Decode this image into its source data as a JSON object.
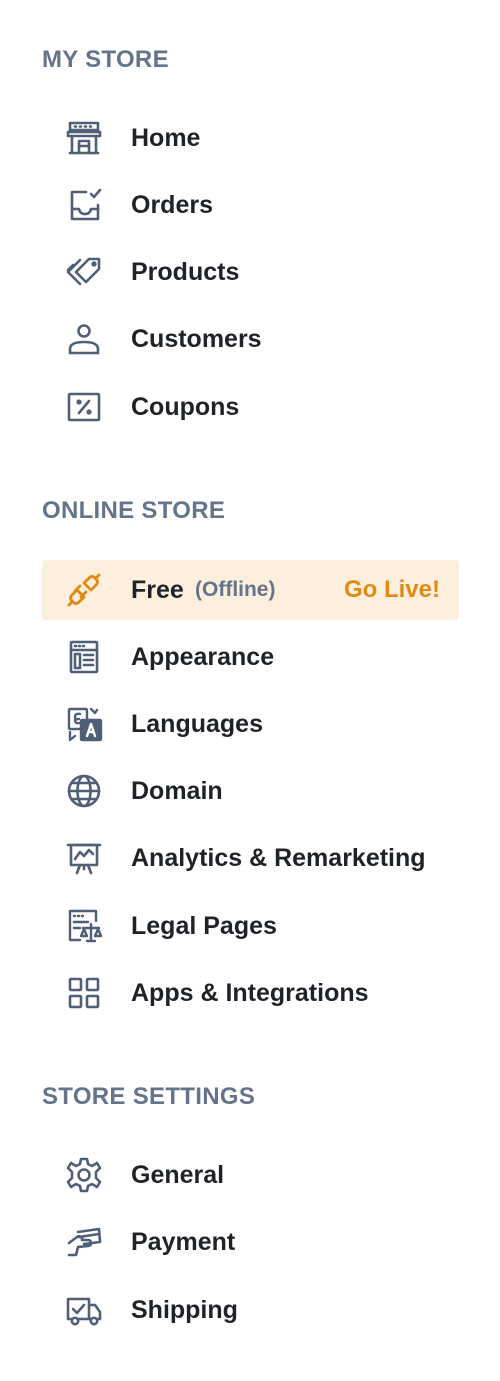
{
  "sections": {
    "my_store": {
      "title": "MY STORE",
      "items": [
        {
          "label": "Home",
          "icon": "storefront-icon"
        },
        {
          "label": "Orders",
          "icon": "inbox-check-icon"
        },
        {
          "label": "Products",
          "icon": "tag-icon"
        },
        {
          "label": "Customers",
          "icon": "person-icon"
        },
        {
          "label": "Coupons",
          "icon": "percent-icon"
        }
      ]
    },
    "online_store": {
      "title": "ONLINE STORE",
      "items": [
        {
          "label": "Free",
          "sub": "(Offline)",
          "cta": "Go Live!",
          "icon": "plug-icon",
          "active": true
        },
        {
          "label": "Appearance",
          "icon": "layout-icon"
        },
        {
          "label": "Languages",
          "icon": "translate-icon"
        },
        {
          "label": "Domain",
          "icon": "globe-icon"
        },
        {
          "label": "Analytics & Remarketing",
          "icon": "presentation-chart-icon"
        },
        {
          "label": "Legal Pages",
          "icon": "document-scale-icon"
        },
        {
          "label": "Apps & Integrations",
          "icon": "apps-grid-icon"
        }
      ]
    },
    "store_settings": {
      "title": "STORE SETTINGS",
      "items": [
        {
          "label": "General",
          "icon": "gear-icon"
        },
        {
          "label": "Payment",
          "icon": "payment-card-icon"
        },
        {
          "label": "Shipping",
          "icon": "truck-icon"
        }
      ]
    }
  },
  "colors": {
    "section_title": "#64748b",
    "label": "#1f2328",
    "icon": "#4f5f75",
    "active_background": "#fdefdd",
    "accent": "#e08a14"
  }
}
